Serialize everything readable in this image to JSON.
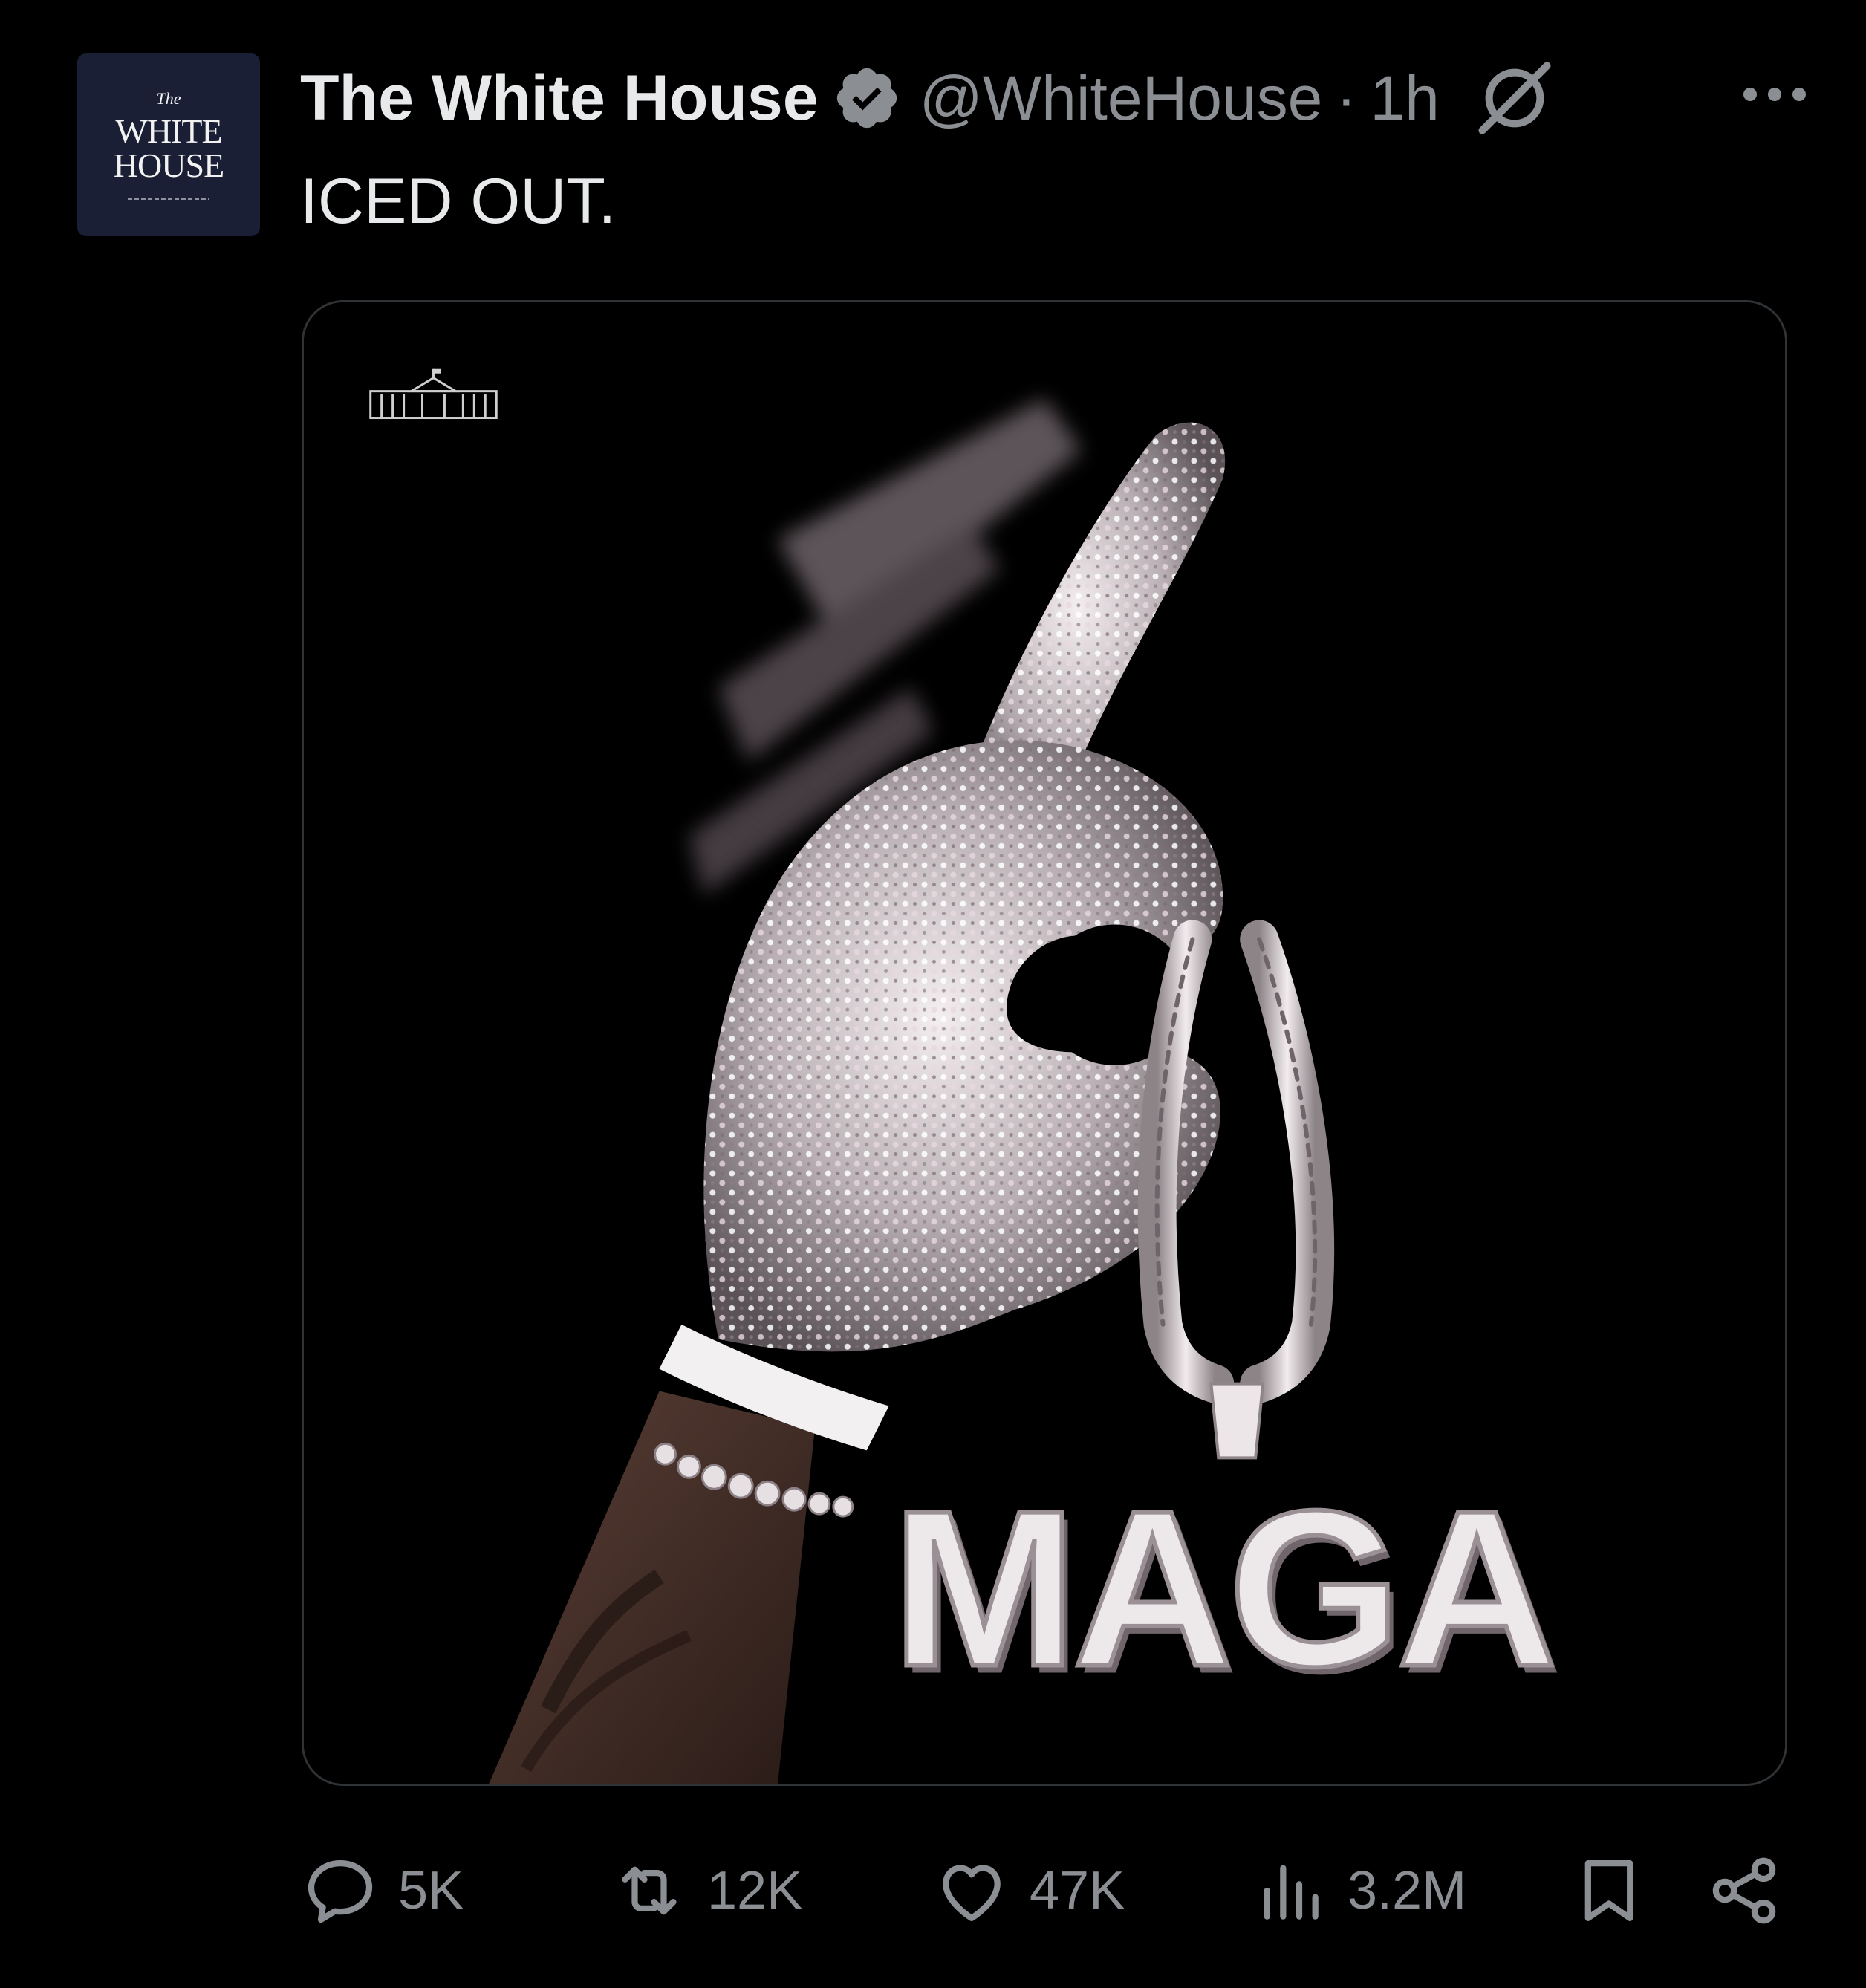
{
  "avatar": {
    "line_the": "The",
    "line_white": "WHITE",
    "line_house": "HOUSE"
  },
  "post": {
    "display_name": "The White House",
    "verified_icon": "verified-badge-icon",
    "handle": "@WhiteHouse",
    "separator": "·",
    "time": "1h",
    "text": "ICED OUT.",
    "grok_icon": "grok-icon",
    "more_icon": "more-options-icon"
  },
  "media": {
    "pendant_text": "MAGA"
  },
  "actions": {
    "replies": "5K",
    "reposts": "12K",
    "likes": "47K",
    "views": "3.2M"
  },
  "colors": {
    "background": "#000000",
    "primary_text": "#e7e9ea",
    "secondary_text": "#8b8f94",
    "verified": "#8b8f94",
    "avatar_bg": "#1b1f35",
    "border": "#2f3336"
  }
}
